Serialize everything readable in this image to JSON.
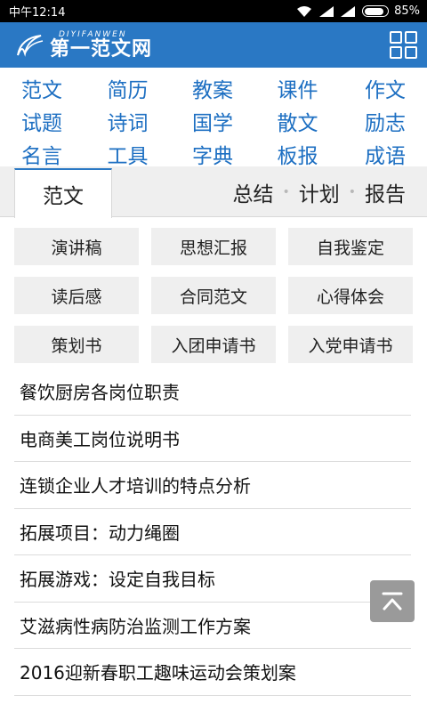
{
  "status_bar": {
    "carrier": "中午12:14",
    "battery_text": "85%",
    "battery_level": 0.85
  },
  "header": {
    "logo_en": "DIYIFANWEN",
    "logo_cn": "第一范文网",
    "menu_icon": "grid-menu-icon"
  },
  "categories": [
    [
      "范文",
      "简历",
      "教案",
      "课件",
      "作文"
    ],
    [
      "试题",
      "诗词",
      "国学",
      "散文",
      "励志"
    ],
    [
      "名言",
      "工具",
      "字典",
      "板报",
      "成语"
    ]
  ],
  "tabs": {
    "active": "范文",
    "others": [
      "总结",
      "计划",
      "报告"
    ],
    "separator": "•"
  },
  "subcategories": [
    "演讲稿",
    "思想汇报",
    "自我鉴定",
    "读后感",
    "合同范文",
    "心得体会",
    "策划书",
    "入团申请书",
    "入党申请书"
  ],
  "articles": [
    "餐饮厨房各岗位职责",
    "电商美工岗位说明书",
    "连锁企业人才培训的特点分析",
    "拓展项目：动力绳圈",
    "拓展游戏：设定自我目标",
    "艾滋病性病防治监测工作方案",
    "2016迎新春职工趣味运动会策划案"
  ],
  "colors": {
    "brand": "#2a78c4",
    "link": "#1d6fc2",
    "button_bg": "#efefef"
  },
  "back_to_top_icon": "back-to-top-icon"
}
